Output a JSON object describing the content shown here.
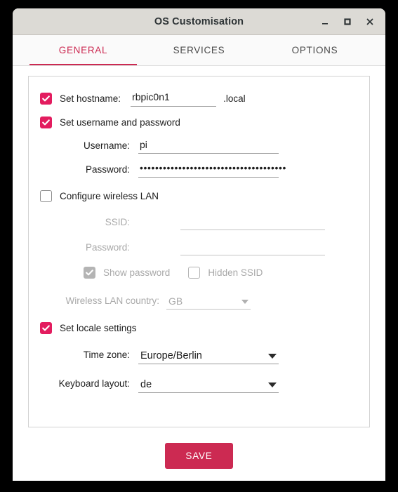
{
  "window": {
    "title": "OS Customisation",
    "controls": [
      {
        "name": "minimize",
        "glyph": "_"
      },
      {
        "name": "maximize",
        "glyph": "□"
      },
      {
        "name": "close",
        "glyph": "✕"
      }
    ]
  },
  "tabs": [
    {
      "label": "GENERAL",
      "active": true
    },
    {
      "label": "SERVICES",
      "active": false
    },
    {
      "label": "OPTIONS",
      "active": false
    }
  ],
  "general": {
    "hostname": {
      "checkbox_label": "Set hostname:",
      "checked": true,
      "value": "rbpic0n1",
      "placeholder": "",
      "suffix": ".local"
    },
    "user": {
      "checkbox_label": "Set username and password",
      "checked": true,
      "username_label": "Username:",
      "username_value": "pi",
      "password_label": "Password:",
      "password_masked": "••••••••••••••••••••••••••••••••••••••"
    },
    "wireless": {
      "checkbox_label": "Configure wireless LAN",
      "checked": false,
      "enabled": false,
      "ssid_label": "SSID:",
      "ssid_value": "",
      "password_label": "Password:",
      "password_value": "",
      "show_password_label": "Show password",
      "show_password_checked": true,
      "hidden_ssid_label": "Hidden SSID",
      "hidden_ssid_checked": false,
      "country_label": "Wireless LAN country:",
      "country_value": "GB"
    },
    "locale": {
      "checkbox_label": "Set locale settings",
      "checked": true,
      "timezone_label": "Time zone:",
      "timezone_value": "Europe/Berlin",
      "keyboard_label": "Keyboard layout:",
      "keyboard_value": "de"
    }
  },
  "footer": {
    "save_label": "SAVE"
  },
  "colors": {
    "accent": "#cc2a52",
    "checkbox_on": "#e31c5f",
    "titlebar": "#dcdad5",
    "disabled_text": "#a9a9a9"
  }
}
